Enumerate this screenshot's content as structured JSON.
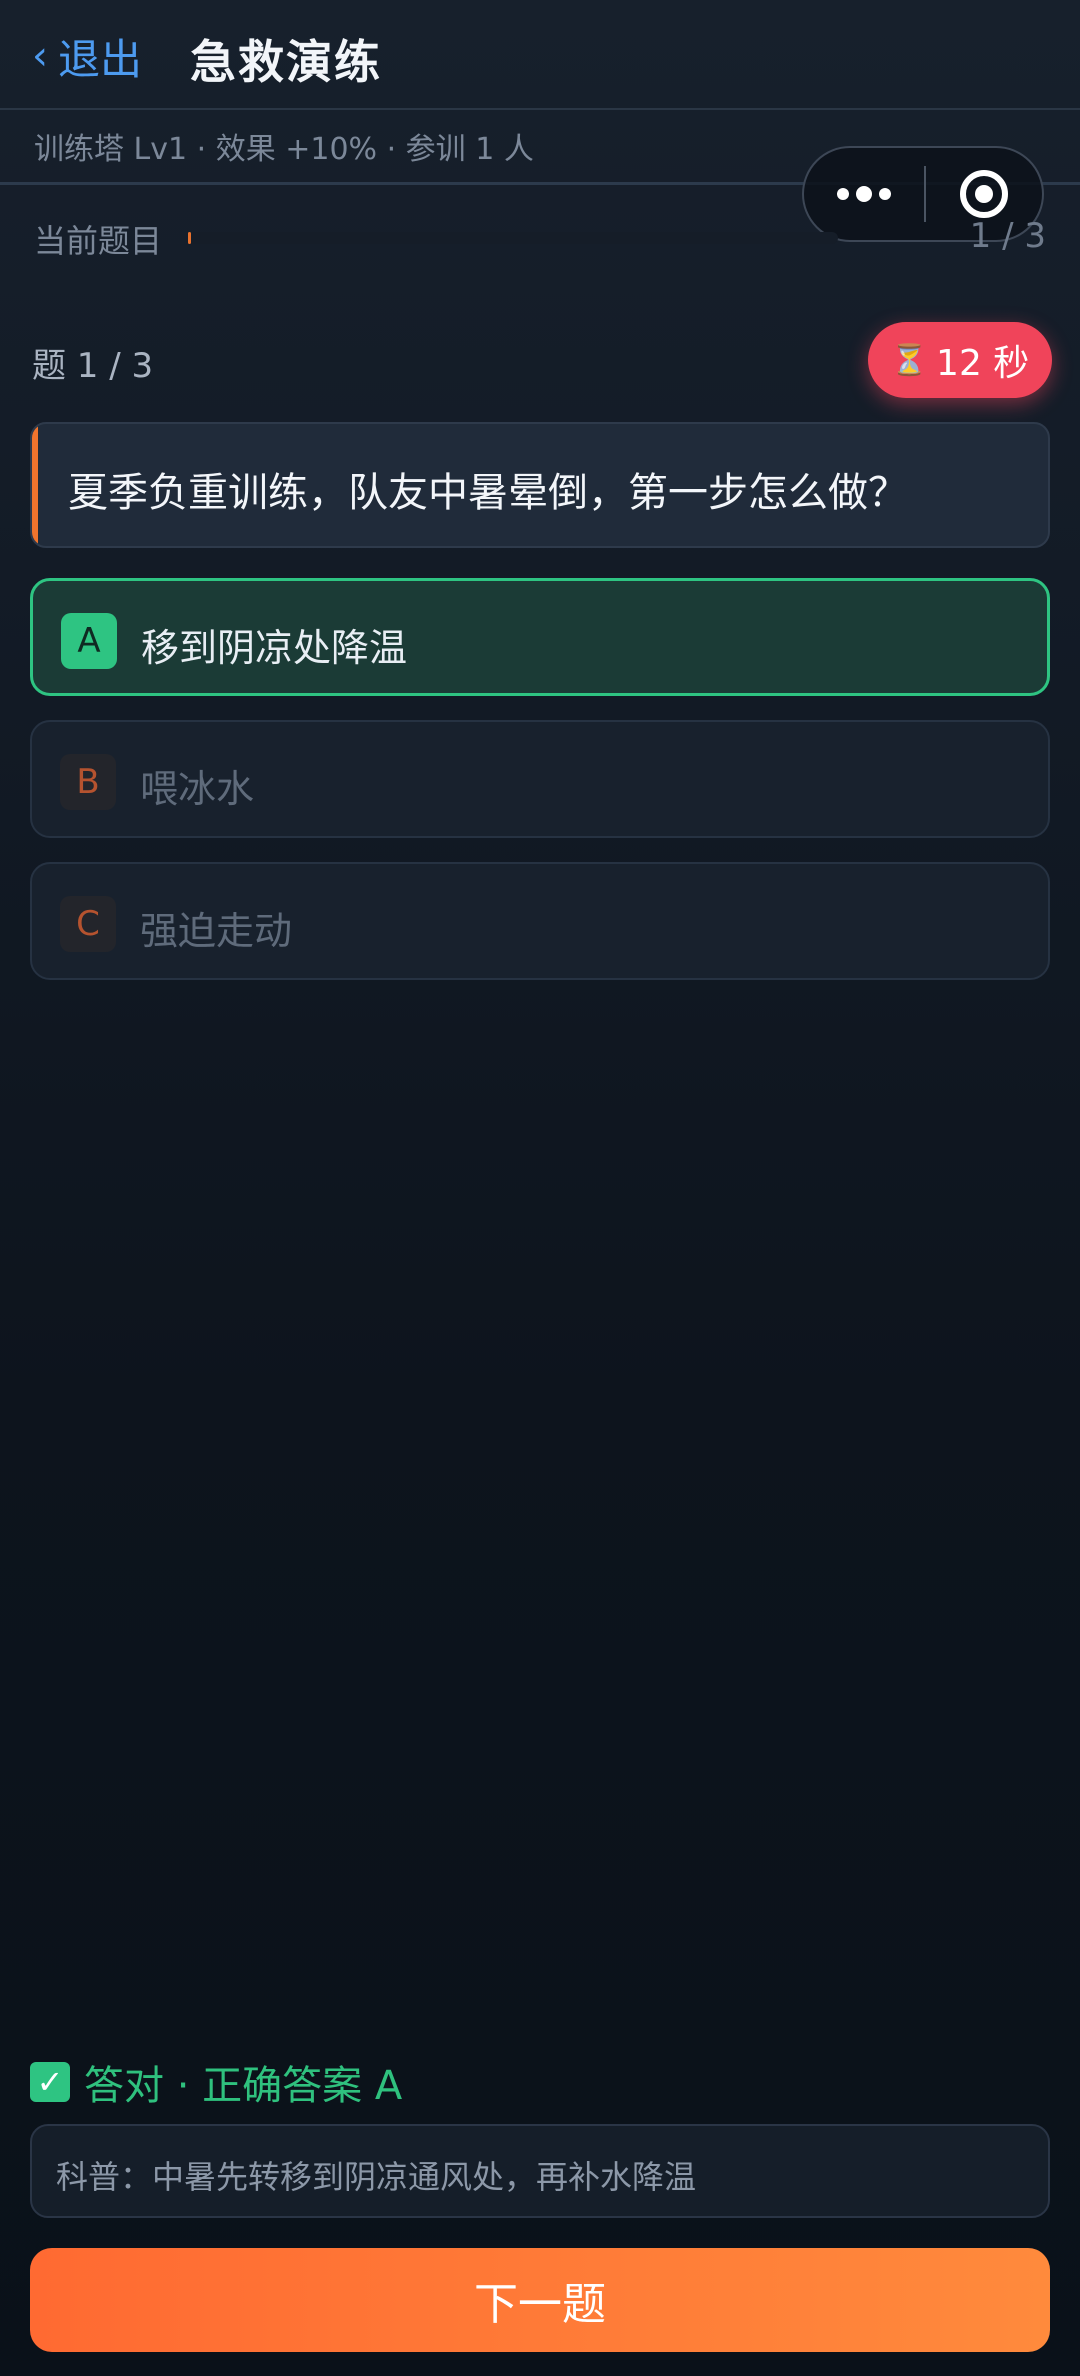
{
  "header": {
    "back_label": "退出",
    "title": "急救演练"
  },
  "subtitle": "训练塔 Lv1 · 效果 +10% · 参训 1 人",
  "progress": {
    "label": "当前题目",
    "count": "1 / 3",
    "fraction": 0.0
  },
  "question": {
    "counter": "题 1 / 3",
    "timer": "12 秒",
    "text": "夏季负重训练，队友中暑晕倒，第一步怎么做？"
  },
  "options": [
    {
      "letter": "A",
      "text": "移到阴凉处降温",
      "state": "correct"
    },
    {
      "letter": "B",
      "text": "喂冰水",
      "state": "disabled"
    },
    {
      "letter": "C",
      "text": "强迫走动",
      "state": "disabled"
    }
  ],
  "result": {
    "text": "答对 · 正确答案 A"
  },
  "tip": "科普：中暑先转移到阴凉通风处，再补水降温",
  "next_button": "下一题",
  "colors": {
    "accent": "#f0742d",
    "correct": "#2ec482",
    "timer": "#f0445a",
    "link": "#4d9bf0"
  },
  "icons": {
    "back": "chevron-left-icon",
    "timer": "hourglass-icon",
    "result": "check-box-icon",
    "menu": "more-dots-icon",
    "close": "target-circle-icon"
  }
}
